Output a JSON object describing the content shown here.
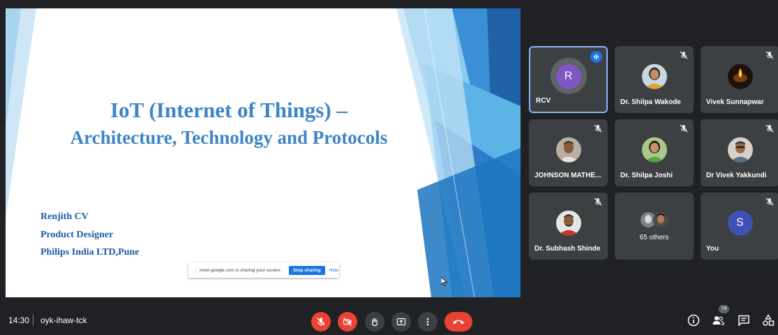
{
  "slide": {
    "title_line1": "IoT (Internet of Things) –",
    "title_line2": "Architecture, Technology and Protocols",
    "presenter_name": "Renjith CV",
    "presenter_role": "Product Designer",
    "presenter_company": "Philips India LTD,Pune"
  },
  "share_notification": {
    "message": "meet.google.com is sharing your screen.",
    "stop_label": "Stop sharing",
    "hide_label": "Hide"
  },
  "participants": [
    {
      "name": "RCV",
      "avatar_letter": "R",
      "avatar_color": "#7e57c2",
      "speaking": true
    },
    {
      "name": "Dr. Shilpa Wakode",
      "muted": true
    },
    {
      "name": "Vivek Sunnapwar",
      "muted": true
    },
    {
      "name": "JOHNSON MATHE...",
      "muted": true
    },
    {
      "name": "Dr. Shilpa Joshi",
      "muted": true
    },
    {
      "name": "Dr Vivek Yakkundi",
      "muted": true
    },
    {
      "name": "Dr. Subhash Shinde",
      "muted": true
    },
    {
      "name": "65 others"
    },
    {
      "name": "You",
      "avatar_letter": "S",
      "avatar_color": "#3f51b5",
      "muted": true
    }
  ],
  "bottom_bar": {
    "time": "14:30",
    "meeting_code": "oyk-ihaw-tck",
    "people_count": "74"
  },
  "icons": [
    "mic-off-icon",
    "camera-off-icon",
    "raise-hand-icon",
    "present-icon",
    "more-options-icon",
    "end-call-icon",
    "info-icon",
    "people-icon",
    "chat-icon",
    "activities-icon"
  ],
  "colors": {
    "background": "#202124",
    "tile": "#3c4043",
    "danger": "#ea4335",
    "accent": "#1a73e8",
    "slide_title": "#3d85c6"
  }
}
